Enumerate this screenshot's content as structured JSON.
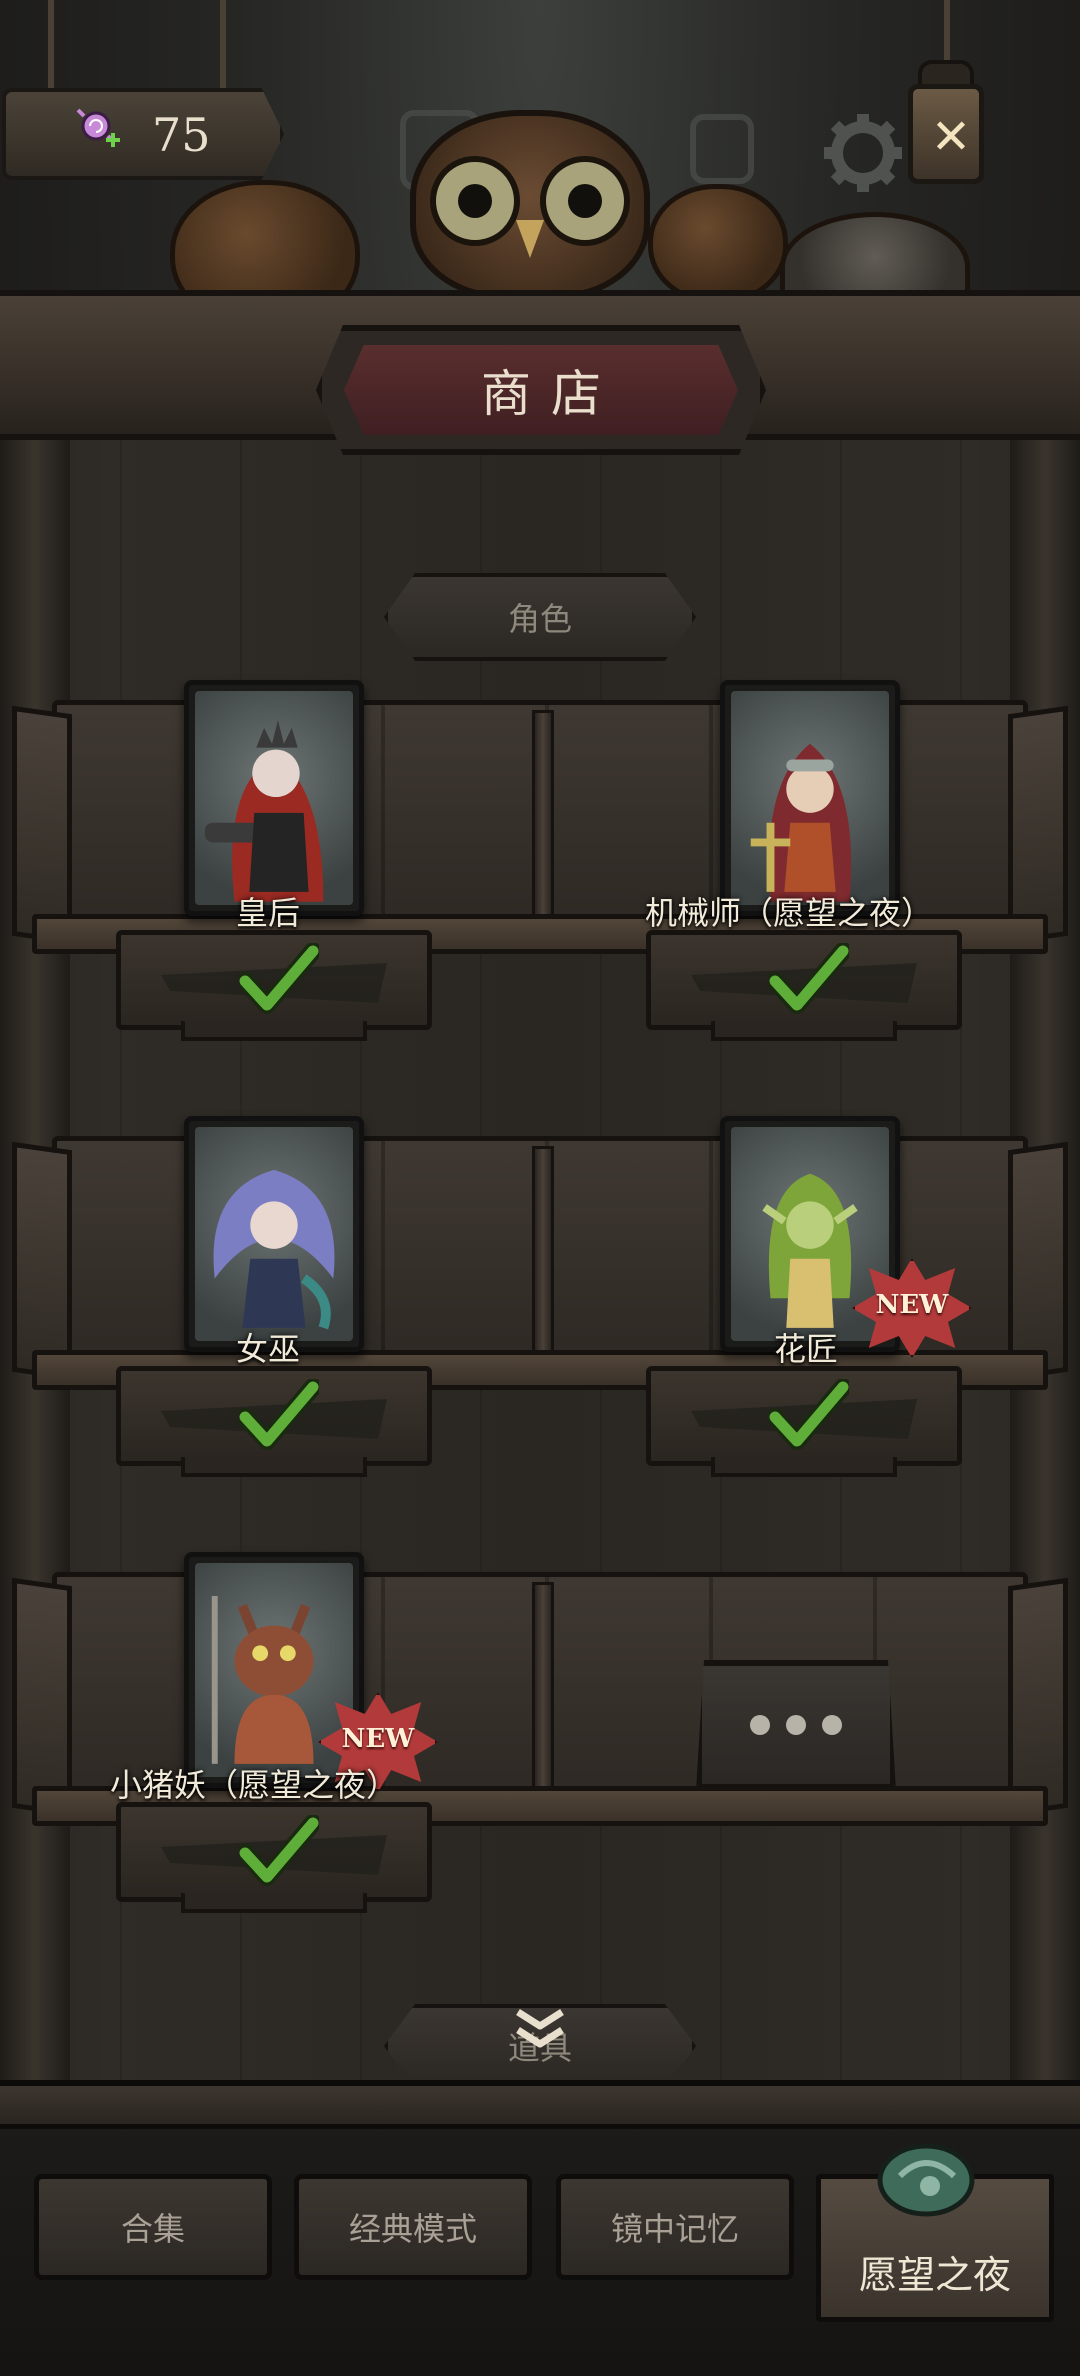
{
  "currency": {
    "icon": "candy-plus-icon",
    "value": "75"
  },
  "header": {
    "title": "商店",
    "close_icon": "close-icon",
    "settings_icon": "gear-icon"
  },
  "section": {
    "label": "角色",
    "next_label": "道具"
  },
  "characters": [
    {
      "name": "皇后",
      "owned": true,
      "is_new": false,
      "portrait": "queen-portrait"
    },
    {
      "name": "机械师（愿望之夜）",
      "owned": true,
      "is_new": false,
      "portrait": "mechanic-portrait"
    },
    {
      "name": "女巫",
      "owned": true,
      "is_new": false,
      "portrait": "witch-portrait"
    },
    {
      "name": "花匠",
      "owned": true,
      "is_new": true,
      "portrait": "gardener-portrait"
    },
    {
      "name": "小猪妖（愿望之夜）",
      "owned": true,
      "is_new": true,
      "portrait": "pig-demon-portrait"
    }
  ],
  "badge": {
    "new": "NEW"
  },
  "tabs": [
    {
      "label": "合集",
      "active": false
    },
    {
      "label": "经典模式",
      "active": false
    },
    {
      "label": "镜中记忆",
      "active": false
    },
    {
      "label": "愿望之夜",
      "active": true
    }
  ],
  "colors": {
    "accent_red": "#b33a3a",
    "check_green": "#5fae3a",
    "title_plaque": "#5a2e2e"
  }
}
